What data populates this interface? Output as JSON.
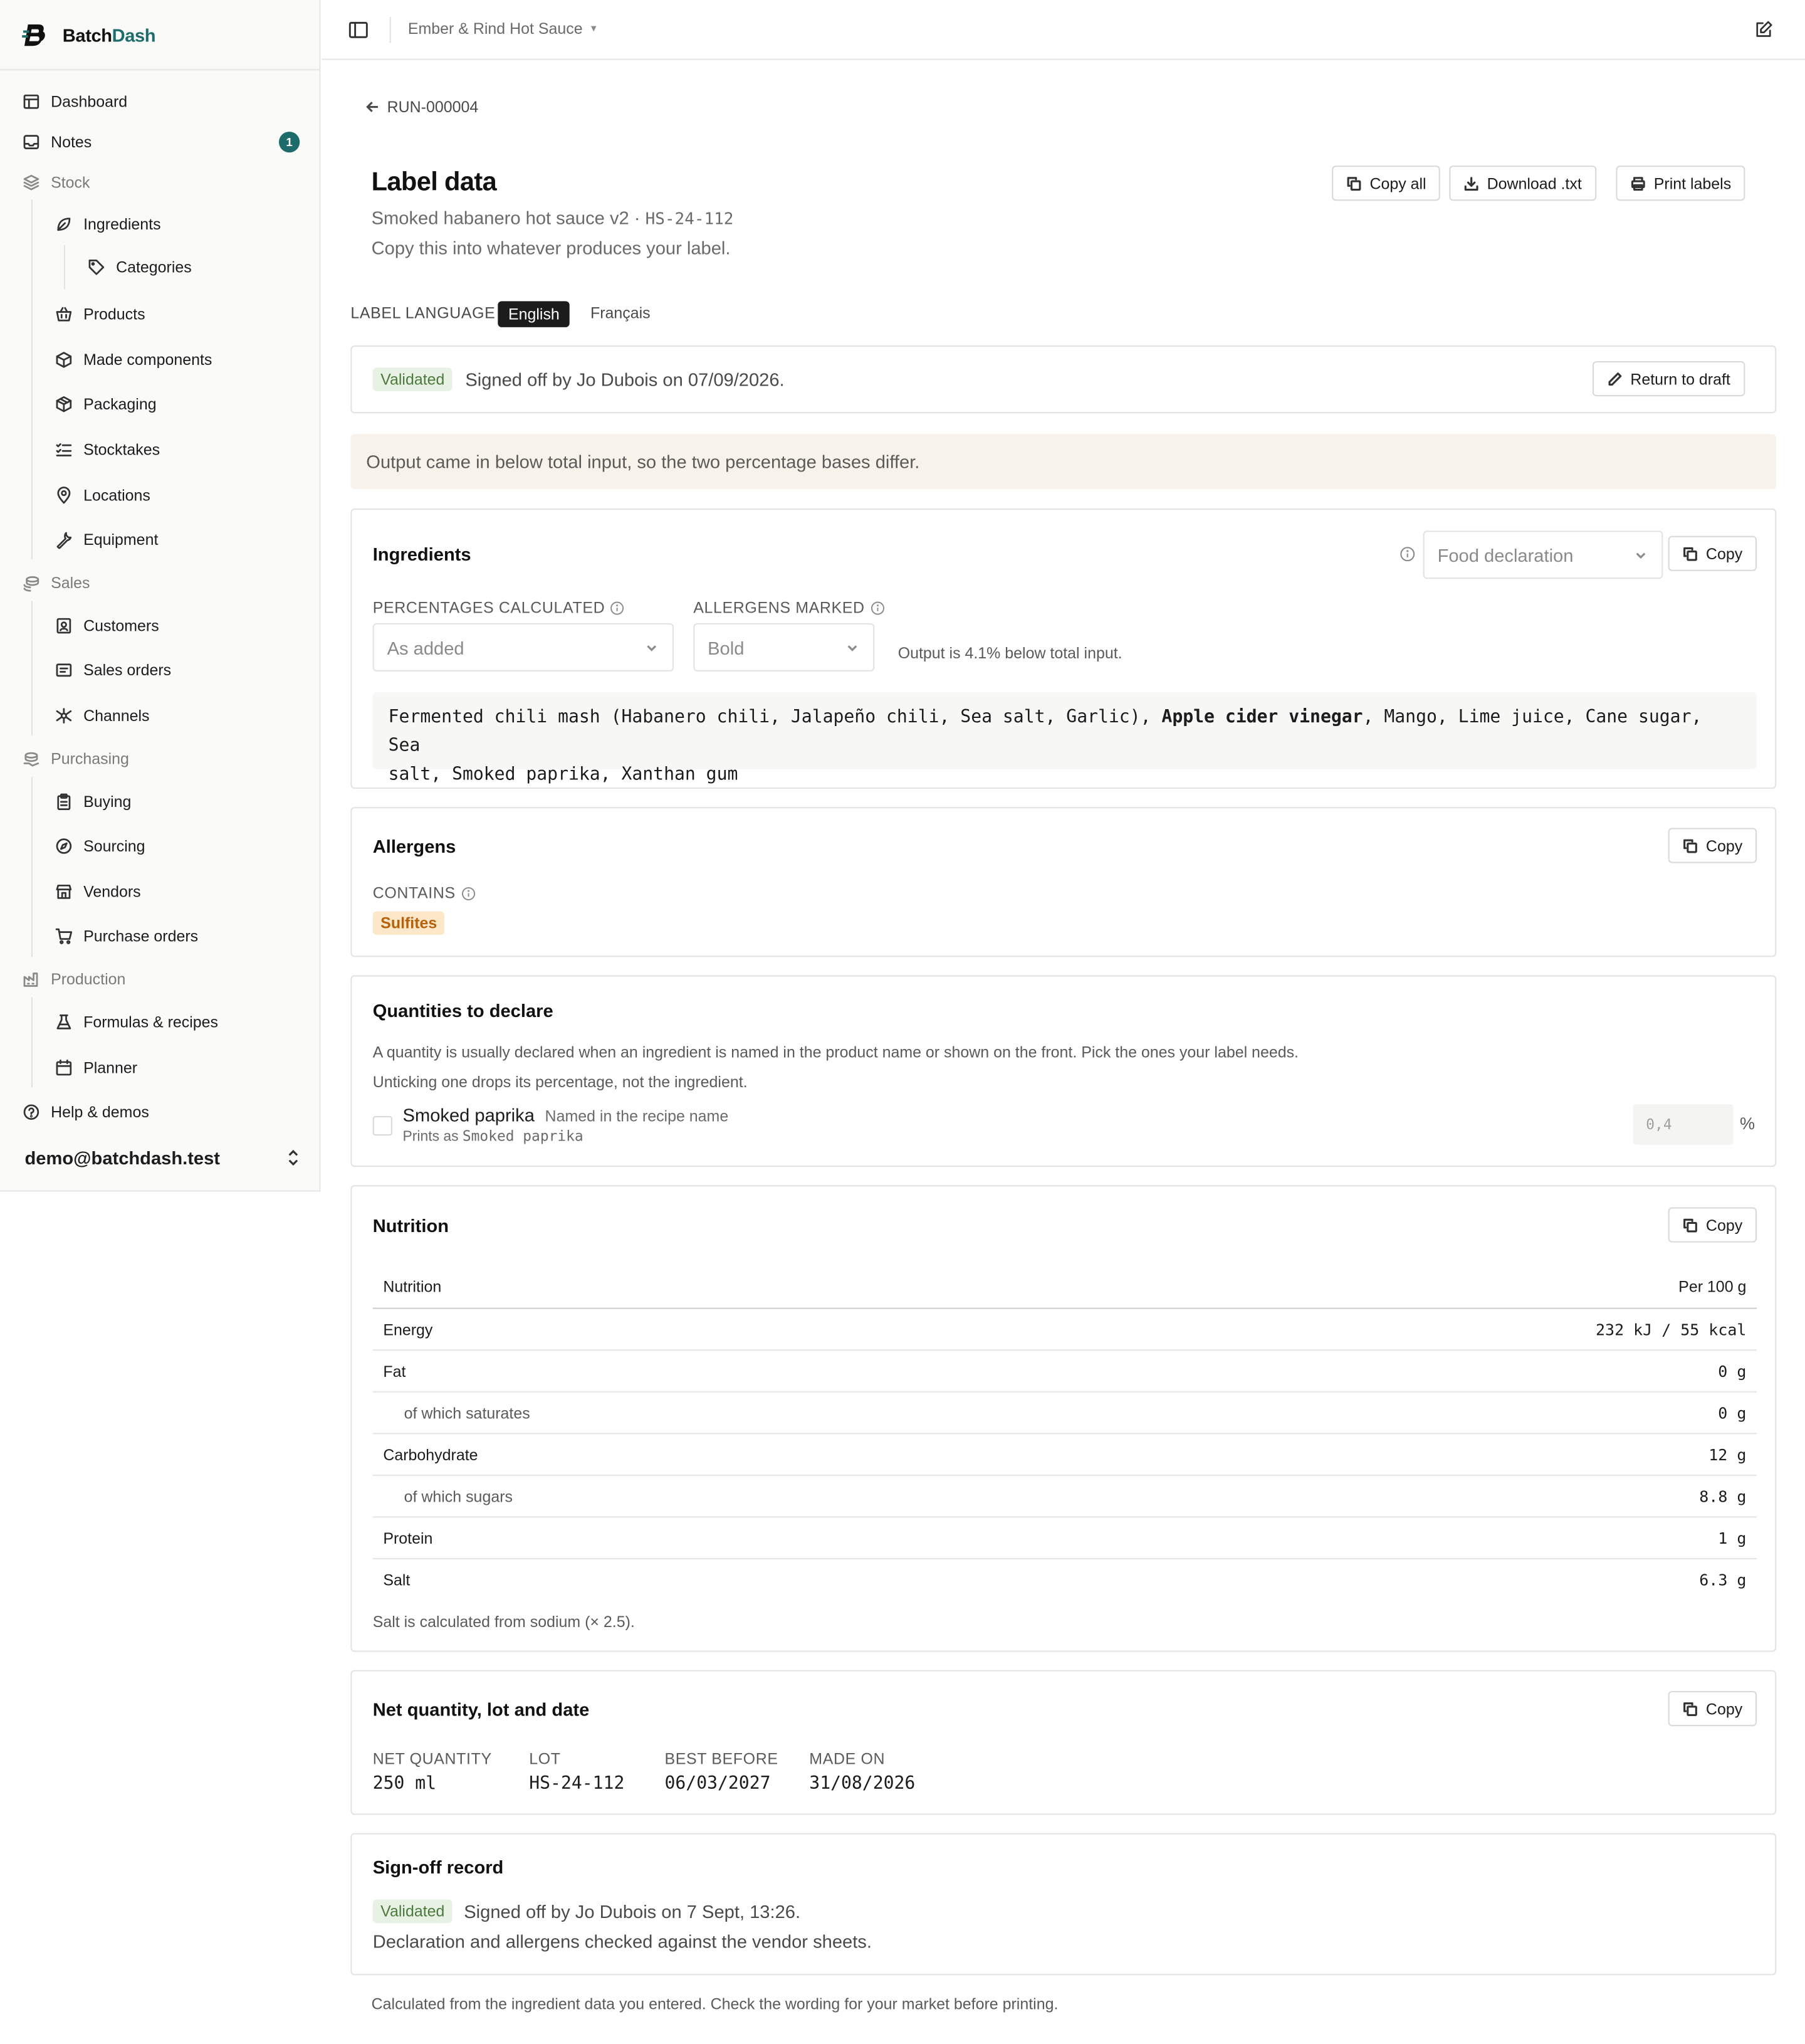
{
  "app": {
    "name_part1": "Batch",
    "name_part2": "Dash"
  },
  "sidebar": {
    "items": [
      {
        "label": "Dashboard",
        "icon": "layout-icon"
      },
      {
        "label": "Notes",
        "icon": "inbox-icon",
        "badge": "1"
      },
      {
        "label": "Stock",
        "icon": "layers-icon"
      },
      {
        "label": "Ingredients",
        "icon": "leaf-icon"
      },
      {
        "label": "Categories",
        "icon": "tag-icon"
      },
      {
        "label": "Products",
        "icon": "basket-icon"
      },
      {
        "label": "Made components",
        "icon": "box-icon"
      },
      {
        "label": "Packaging",
        "icon": "package-icon"
      },
      {
        "label": "Stocktakes",
        "icon": "checklist-icon"
      },
      {
        "label": "Locations",
        "icon": "map-pin-icon"
      },
      {
        "label": "Equipment",
        "icon": "wrench-icon"
      },
      {
        "label": "Sales",
        "icon": "coins-icon"
      },
      {
        "label": "Customers",
        "icon": "contact-icon"
      },
      {
        "label": "Sales orders",
        "icon": "receipt-icon"
      },
      {
        "label": "Channels",
        "icon": "network-icon"
      },
      {
        "label": "Purchasing",
        "icon": "hand-coins-icon"
      },
      {
        "label": "Buying",
        "icon": "clipboard-icon"
      },
      {
        "label": "Sourcing",
        "icon": "compass-icon"
      },
      {
        "label": "Vendors",
        "icon": "store-icon"
      },
      {
        "label": "Purchase orders",
        "icon": "cart-icon"
      },
      {
        "label": "Production",
        "icon": "factory-icon"
      },
      {
        "label": "Formulas & recipes",
        "icon": "flask-icon"
      },
      {
        "label": "Planner",
        "icon": "calendar-icon"
      },
      {
        "label": "Help & demos",
        "icon": "help-icon"
      }
    ],
    "user_email": "demo@batchdash.test"
  },
  "topbar": {
    "workspace": "Ember & Rind Hot Sauce"
  },
  "header": {
    "back_label": "RUN-000004",
    "title": "Label data",
    "subtitle_product": "Smoked habanero hot sauce v2 · ",
    "subtitle_lot": "HS-24-112",
    "hint": "Copy this into whatever produces your label.",
    "actions": {
      "copy_all": "Copy all",
      "download": "Download .txt",
      "print": "Print labels"
    }
  },
  "language": {
    "label": "LABEL LANGUAGE",
    "active": "English",
    "other": "Français"
  },
  "status": {
    "tag": "Validated",
    "text": "Signed off by Jo Dubois on 07/09/2026.",
    "action": "Return to draft"
  },
  "notice": "Output came in below total input, so the two percentage bases differ.",
  "ingredients": {
    "title": "Ingredients",
    "declaration_select": "Food declaration",
    "copy": "Copy",
    "percent_label": "PERCENTAGES CALCULATED",
    "percent_value": "As added",
    "allergen_label": "ALLERGENS MARKED",
    "allergen_value": "Bold",
    "output_note": "Output is 4.1% below total input.",
    "text_before": "Fermented chili mash (Habanero chili, Jalapeño chili, Sea salt, Garlic), ",
    "text_bold": "Apple cider vinegar",
    "text_line1_after": ", Mango, Lime juice, Cane sugar, Sea",
    "text_line2": "salt, Smoked paprika, Xanthan gum"
  },
  "allergens": {
    "title": "Allergens",
    "copy": "Copy",
    "contains_label": "CONTAINS",
    "items": [
      "Sulfites"
    ]
  },
  "quantities": {
    "title": "Quantities to declare",
    "desc1": "A quantity is usually declared when an ingredient is named in the product name or shown on the front. Pick the ones your label needs.",
    "desc2": "Unticking one drops its percentage, not the ingredient.",
    "item_name": "Smoked paprika",
    "item_reason": "Named in the recipe name",
    "prints_as_label": "Prints as ",
    "prints_as_value": "Smoked paprika",
    "placeholder": "0,4",
    "unit": "%"
  },
  "nutrition": {
    "title": "Nutrition",
    "copy": "Copy",
    "col_label": "Nutrition",
    "col_value": "Per 100 g",
    "rows": [
      {
        "label": "Energy",
        "value": "232 kJ / 55 kcal",
        "sub": false
      },
      {
        "label": "Fat",
        "value": "0 g",
        "sub": false
      },
      {
        "label": "of which saturates",
        "value": "0 g",
        "sub": true
      },
      {
        "label": "Carbohydrate",
        "value": "12 g",
        "sub": false
      },
      {
        "label": "of which sugars",
        "value": "8.8 g",
        "sub": true
      },
      {
        "label": "Protein",
        "value": "1 g",
        "sub": false
      },
      {
        "label": "Salt",
        "value": "6.3 g",
        "sub": false
      }
    ],
    "note": "Salt is calculated from sodium (× 2.5)."
  },
  "netqty": {
    "title": "Net quantity, lot and date",
    "copy": "Copy",
    "fields": [
      {
        "label": "NET QUANTITY",
        "value": "250 ml"
      },
      {
        "label": "LOT",
        "value": "HS-24-112"
      },
      {
        "label": "BEST BEFORE",
        "value": "06/03/2027"
      },
      {
        "label": "MADE ON",
        "value": "31/08/2026"
      }
    ]
  },
  "signoff": {
    "title": "Sign-off record",
    "tag": "Validated",
    "text": "Signed off by Jo Dubois on 7 Sept, 13:26.",
    "detail": "Declaration and allergens checked against the vendor sheets."
  },
  "footer_note": "Calculated from the ingredient data you entered. Check the wording for your market before printing.",
  "colors": {
    "brand": "#1d6b6b",
    "validated_bg": "#e8f2e4",
    "allergen_bg": "#fce7c8",
    "notice_bg": "#f7f3ea"
  }
}
